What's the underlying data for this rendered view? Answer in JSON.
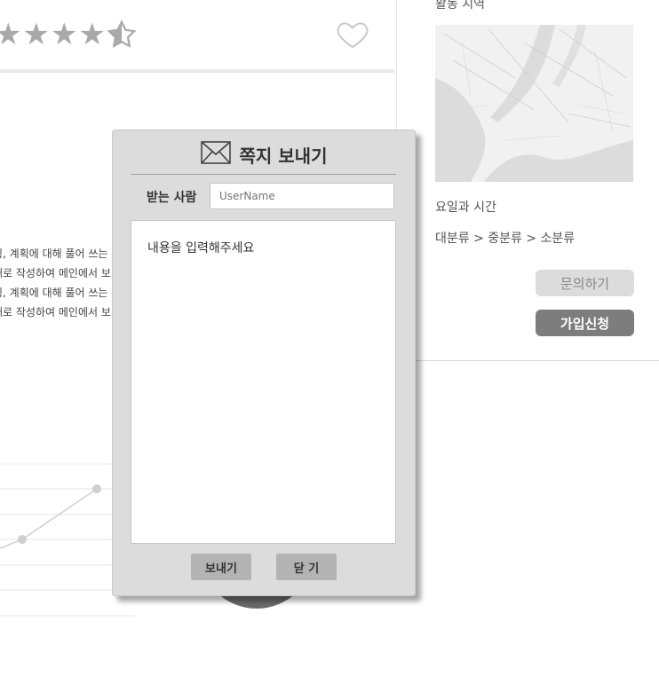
{
  "rating": {
    "value": 4.5,
    "max": 5
  },
  "description_lines": [
    "링, 계획에 대해 풀어 쓰는",
    "대로 작성하여 메인에서 보",
    "링, 계획에 대해 풀어 쓰는",
    "대로 작성하여 메인에서 보"
  ],
  "right_panel": {
    "area_title": "활동 지역",
    "schedule_label": "요일과 시간",
    "category_path": "대분류 > 중분류 > 소분류",
    "inquiry_button": "문의하기",
    "join_button": "가입신청"
  },
  "modal": {
    "title": "쪽지 보내기",
    "recipient_label": "받는 사람",
    "recipient_placeholder": "UserName",
    "body_placeholder": "내용을 입력해주세요",
    "send_button": "보내기",
    "close_button": "닫 기"
  },
  "icons": {
    "star": "star-icon",
    "heart": "heart-icon",
    "mail": "mail-envelope-icon"
  }
}
